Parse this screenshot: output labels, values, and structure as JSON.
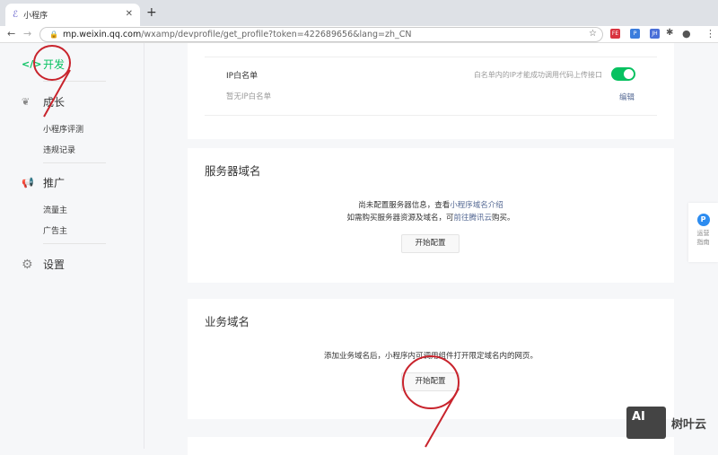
{
  "browser": {
    "tab_title": "小程序",
    "url_host": "mp.weixin.qq.com",
    "url_path": "/wxamp/devprofile/get_profile?token=422689656&lang=zh_CN",
    "extensions": [
      {
        "label": "FE",
        "color": "#d9333f"
      },
      {
        "label": "P",
        "color": "#3b7ddd"
      },
      {
        "label": "JH",
        "color": "#4a6fd8"
      }
    ]
  },
  "sidebar": {
    "develop": "开发",
    "grow": "成长",
    "grow_items": [
      "小程序评测",
      "违规记录"
    ],
    "promote": "推广",
    "promote_items": [
      "流量主",
      "广告主"
    ],
    "settings": "设置"
  },
  "ip_whitelist": {
    "label": "IP白名单",
    "empty": "暂无IP白名单",
    "hint": "白名单内的IP才能成功调用代码上传接口",
    "edit": "编辑",
    "enabled": true
  },
  "server_domain": {
    "title": "服务器域名",
    "line1": "尚未配置服务器信息，查看",
    "line1_link": "小程序域名介绍",
    "line2": "如需购买服务器资源及域名，可",
    "line2_link": "前往腾讯云",
    "line2_end": "购买。",
    "button": "开始配置"
  },
  "business_domain": {
    "title": "业务域名",
    "desc": "添加业务域名后，小程序内可调用组件打开限定域名内的网页。",
    "button": "开始配置"
  },
  "float_widget": {
    "icon": "P",
    "label1": "运营",
    "label2": "指南"
  },
  "watermark": {
    "logo": "AI",
    "text": "树叶云"
  },
  "accent": "#07c160"
}
